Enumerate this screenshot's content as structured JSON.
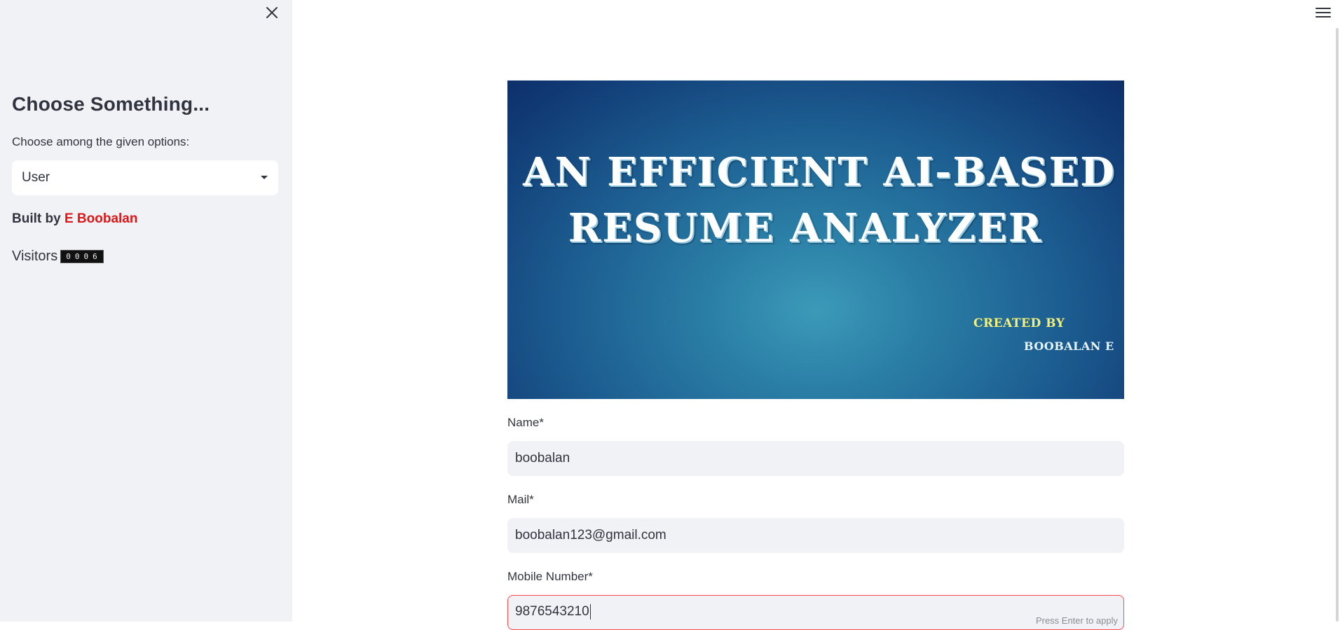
{
  "sidebar": {
    "heading": "Choose Something...",
    "select_label": "Choose among the given options:",
    "select_value": "User",
    "built_by_prefix": "Built by ",
    "author": "E Boobalan",
    "visitors_label": "Visitors",
    "visitor_count": "0006"
  },
  "banner": {
    "title_line1": "AN EFFICIENT AI-BASED",
    "title_line2": "RESUME ANALYZER",
    "created_by": "CREATED BY",
    "author": "BOOBALAN E"
  },
  "form": {
    "name_label": "Name*",
    "name_value": "boobalan",
    "mail_label": "Mail*",
    "mail_value": "boobalan123@gmail.com",
    "mobile_label": "Mobile Number*",
    "mobile_value": "9876543210",
    "enter_hint": "Press Enter to apply"
  },
  "colors": {
    "accent": "#ff4b4b",
    "author": "#e01515",
    "sidebar_bg": "#f0f2f6"
  }
}
